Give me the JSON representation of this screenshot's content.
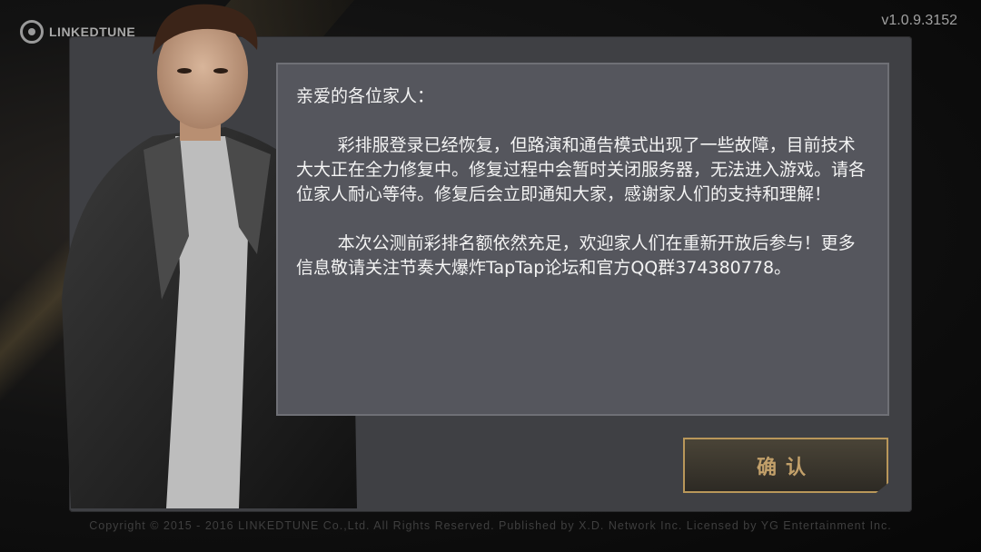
{
  "header": {
    "logo_text": "LINKEDTUNE",
    "version": "v1.0.9.3152"
  },
  "notice": {
    "greeting": "亲爱的各位家人：",
    "paragraph1": "彩排服登录已经恢复，但路演和通告模式出现了一些故障，目前技术大大正在全力修复中。修复过程中会暂时关闭服务器，无法进入游戏。请各位家人耐心等待。修复后会立即通知大家，感谢家人们的支持和理解！",
    "paragraph2": "本次公测前彩排名额依然充足，欢迎家人们在重新开放后参与！更多信息敬请关注节奏大爆炸TapTap论坛和官方QQ群374380778。"
  },
  "buttons": {
    "confirm_label": "确认"
  },
  "footer": {
    "copyright": "Copyright © 2015 - 2016 LINKEDTUNE Co.,Ltd. All Rights Reserved. Published by X.D. Network Inc. Licensed by YG Entertainment Inc."
  },
  "colors": {
    "panel": "#3f4044",
    "notice_bg": "#55565d",
    "accent_gold": "#b9975a"
  }
}
